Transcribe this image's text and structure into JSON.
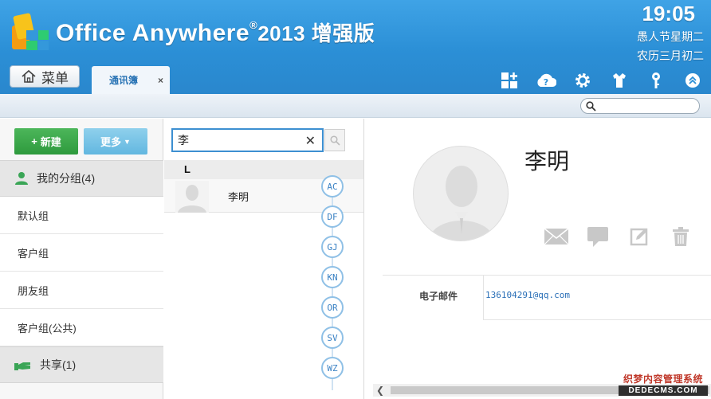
{
  "header": {
    "brand": "Office Anywhere",
    "registered": "®",
    "version": "2013 增强版",
    "time": "19:05",
    "date_line": "愚人节星期二",
    "lunar_line": "农历三月初二",
    "menu_label": "菜单",
    "tab_label": "通讯簿",
    "tab_close": "×",
    "tool_icons": [
      "apps-icon",
      "cloud-help-icon",
      "settings-icon",
      "shirt-icon",
      "key-icon",
      "collapse-icon"
    ]
  },
  "sidebar": {
    "new_label": "新建",
    "more_label": "更多",
    "my_groups": "我的分组(4)",
    "groups": [
      "默认组",
      "客户组",
      "朋友组",
      "客户组(公共)"
    ],
    "shared": "共享(1)"
  },
  "contact_list": {
    "search_value": "李",
    "letter": "L",
    "contacts": [
      {
        "name": "李明"
      }
    ],
    "index": [
      "AC",
      "DF",
      "GJ",
      "KN",
      "OR",
      "SV",
      "WZ"
    ]
  },
  "detail": {
    "name": "李明",
    "action_icons": [
      "mail-icon",
      "chat-icon",
      "edit-icon",
      "trash-icon"
    ],
    "email_label": "电子邮件",
    "email_value": "136104291@qq.com"
  },
  "watermark": {
    "line1": "织梦内容管理系统",
    "line2": "DEDECMS.COM"
  }
}
